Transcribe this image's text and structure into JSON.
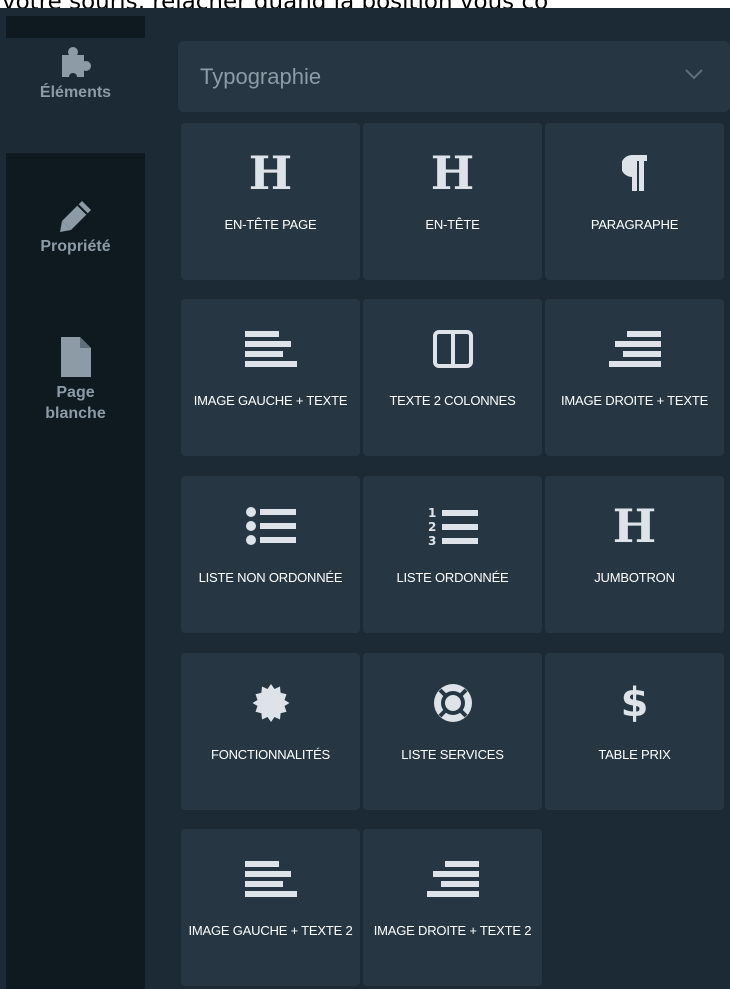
{
  "instruction_text": "votre souris, relâcher quand la position vous co",
  "sidebar": {
    "items": [
      {
        "label": "Éléments",
        "icon": "puzzle-icon"
      },
      {
        "label": "Propriété",
        "icon": "pencil-icon"
      },
      {
        "label": "Page blanche",
        "icon": "file-icon"
      }
    ]
  },
  "category_dropdown": {
    "selected": "Typographie"
  },
  "tiles": [
    {
      "label": "EN-TÊTE PAGE",
      "icon": "heading-icon"
    },
    {
      "label": "EN-TÊTE",
      "icon": "heading-icon"
    },
    {
      "label": "PARAGRAPHE",
      "icon": "paragraph-icon"
    },
    {
      "label": "IMAGE GAUCHE + TEXTE",
      "icon": "align-left-icon"
    },
    {
      "label": "TEXTE 2 COLONNES",
      "icon": "columns-icon"
    },
    {
      "label": "IMAGE DROITE + TEXTE",
      "icon": "align-right-icon"
    },
    {
      "label": "LISTE NON ORDONNÉE",
      "icon": "list-ul-icon"
    },
    {
      "label": "LISTE ORDONNÉE",
      "icon": "list-ol-icon"
    },
    {
      "label": "JUMBOTRON",
      "icon": "heading-icon"
    },
    {
      "label": "FONCTIONNALITÉS",
      "icon": "certificate-icon"
    },
    {
      "label": "LISTE SERVICES",
      "icon": "life-ring-icon"
    },
    {
      "label": "TABLE PRIX",
      "icon": "dollar-icon"
    },
    {
      "label": "IMAGE GAUCHE + TEXTE 2",
      "icon": "align-left-icon"
    },
    {
      "label": "IMAGE DROITE + TEXTE 2",
      "icon": "align-right-icon"
    }
  ],
  "colors": {
    "panel_bg": "#1b2a34",
    "sidebar_bg": "#0f1920",
    "tile_bg": "#263743",
    "muted_text": "#8c9ba6",
    "icon_color": "#dde3e8"
  }
}
